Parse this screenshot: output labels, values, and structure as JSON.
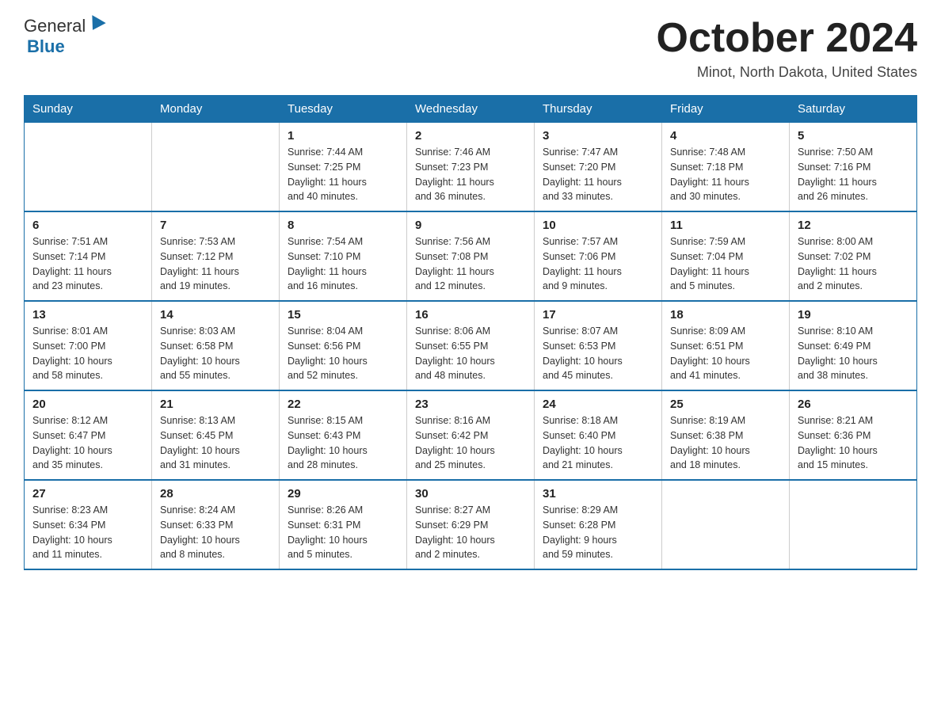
{
  "logo": {
    "general": "General",
    "blue": "Blue"
  },
  "title": {
    "month": "October 2024",
    "location": "Minot, North Dakota, United States"
  },
  "headers": [
    "Sunday",
    "Monday",
    "Tuesday",
    "Wednesday",
    "Thursday",
    "Friday",
    "Saturday"
  ],
  "weeks": [
    [
      {
        "day": "",
        "info": ""
      },
      {
        "day": "",
        "info": ""
      },
      {
        "day": "1",
        "info": "Sunrise: 7:44 AM\nSunset: 7:25 PM\nDaylight: 11 hours\nand 40 minutes."
      },
      {
        "day": "2",
        "info": "Sunrise: 7:46 AM\nSunset: 7:23 PM\nDaylight: 11 hours\nand 36 minutes."
      },
      {
        "day": "3",
        "info": "Sunrise: 7:47 AM\nSunset: 7:20 PM\nDaylight: 11 hours\nand 33 minutes."
      },
      {
        "day": "4",
        "info": "Sunrise: 7:48 AM\nSunset: 7:18 PM\nDaylight: 11 hours\nand 30 minutes."
      },
      {
        "day": "5",
        "info": "Sunrise: 7:50 AM\nSunset: 7:16 PM\nDaylight: 11 hours\nand 26 minutes."
      }
    ],
    [
      {
        "day": "6",
        "info": "Sunrise: 7:51 AM\nSunset: 7:14 PM\nDaylight: 11 hours\nand 23 minutes."
      },
      {
        "day": "7",
        "info": "Sunrise: 7:53 AM\nSunset: 7:12 PM\nDaylight: 11 hours\nand 19 minutes."
      },
      {
        "day": "8",
        "info": "Sunrise: 7:54 AM\nSunset: 7:10 PM\nDaylight: 11 hours\nand 16 minutes."
      },
      {
        "day": "9",
        "info": "Sunrise: 7:56 AM\nSunset: 7:08 PM\nDaylight: 11 hours\nand 12 minutes."
      },
      {
        "day": "10",
        "info": "Sunrise: 7:57 AM\nSunset: 7:06 PM\nDaylight: 11 hours\nand 9 minutes."
      },
      {
        "day": "11",
        "info": "Sunrise: 7:59 AM\nSunset: 7:04 PM\nDaylight: 11 hours\nand 5 minutes."
      },
      {
        "day": "12",
        "info": "Sunrise: 8:00 AM\nSunset: 7:02 PM\nDaylight: 11 hours\nand 2 minutes."
      }
    ],
    [
      {
        "day": "13",
        "info": "Sunrise: 8:01 AM\nSunset: 7:00 PM\nDaylight: 10 hours\nand 58 minutes."
      },
      {
        "day": "14",
        "info": "Sunrise: 8:03 AM\nSunset: 6:58 PM\nDaylight: 10 hours\nand 55 minutes."
      },
      {
        "day": "15",
        "info": "Sunrise: 8:04 AM\nSunset: 6:56 PM\nDaylight: 10 hours\nand 52 minutes."
      },
      {
        "day": "16",
        "info": "Sunrise: 8:06 AM\nSunset: 6:55 PM\nDaylight: 10 hours\nand 48 minutes."
      },
      {
        "day": "17",
        "info": "Sunrise: 8:07 AM\nSunset: 6:53 PM\nDaylight: 10 hours\nand 45 minutes."
      },
      {
        "day": "18",
        "info": "Sunrise: 8:09 AM\nSunset: 6:51 PM\nDaylight: 10 hours\nand 41 minutes."
      },
      {
        "day": "19",
        "info": "Sunrise: 8:10 AM\nSunset: 6:49 PM\nDaylight: 10 hours\nand 38 minutes."
      }
    ],
    [
      {
        "day": "20",
        "info": "Sunrise: 8:12 AM\nSunset: 6:47 PM\nDaylight: 10 hours\nand 35 minutes."
      },
      {
        "day": "21",
        "info": "Sunrise: 8:13 AM\nSunset: 6:45 PM\nDaylight: 10 hours\nand 31 minutes."
      },
      {
        "day": "22",
        "info": "Sunrise: 8:15 AM\nSunset: 6:43 PM\nDaylight: 10 hours\nand 28 minutes."
      },
      {
        "day": "23",
        "info": "Sunrise: 8:16 AM\nSunset: 6:42 PM\nDaylight: 10 hours\nand 25 minutes."
      },
      {
        "day": "24",
        "info": "Sunrise: 8:18 AM\nSunset: 6:40 PM\nDaylight: 10 hours\nand 21 minutes."
      },
      {
        "day": "25",
        "info": "Sunrise: 8:19 AM\nSunset: 6:38 PM\nDaylight: 10 hours\nand 18 minutes."
      },
      {
        "day": "26",
        "info": "Sunrise: 8:21 AM\nSunset: 6:36 PM\nDaylight: 10 hours\nand 15 minutes."
      }
    ],
    [
      {
        "day": "27",
        "info": "Sunrise: 8:23 AM\nSunset: 6:34 PM\nDaylight: 10 hours\nand 11 minutes."
      },
      {
        "day": "28",
        "info": "Sunrise: 8:24 AM\nSunset: 6:33 PM\nDaylight: 10 hours\nand 8 minutes."
      },
      {
        "day": "29",
        "info": "Sunrise: 8:26 AM\nSunset: 6:31 PM\nDaylight: 10 hours\nand 5 minutes."
      },
      {
        "day": "30",
        "info": "Sunrise: 8:27 AM\nSunset: 6:29 PM\nDaylight: 10 hours\nand 2 minutes."
      },
      {
        "day": "31",
        "info": "Sunrise: 8:29 AM\nSunset: 6:28 PM\nDaylight: 9 hours\nand 59 minutes."
      },
      {
        "day": "",
        "info": ""
      },
      {
        "day": "",
        "info": ""
      }
    ]
  ]
}
